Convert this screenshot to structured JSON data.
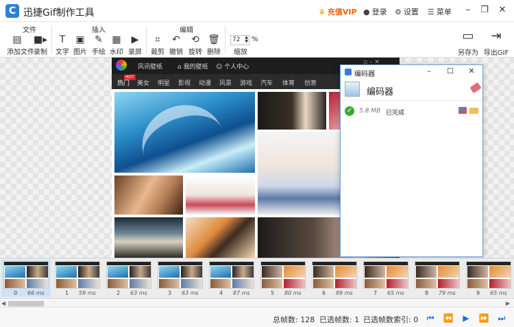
{
  "app": {
    "title": "迅捷Gif制作工具",
    "logo_letter": "C"
  },
  "titlebar": {
    "vip": "充值VIP",
    "login": "登录",
    "settings": "设置",
    "menu": "菜单"
  },
  "ribbon": {
    "groups": {
      "file": "文件",
      "insert": "插入",
      "edit": "编辑"
    },
    "tools": {
      "add_file": "添加文件",
      "record": "录制",
      "text": "文字",
      "image": "图片",
      "draw": "手绘",
      "watermark": "水印",
      "screen_rec": "录屏",
      "crop": "裁剪",
      "undo": "撤销",
      "rotate": "旋转",
      "delete": "删除",
      "zoom_value": "72",
      "zoom_unit": "%",
      "zoom_label": "缩放",
      "save_as": "另存为",
      "export_gif": "导出GIF"
    }
  },
  "site": {
    "links": [
      "风讯壁纸",
      "我的壁纸",
      "个人中心"
    ],
    "nav": [
      "热门",
      "美女",
      "明星",
      "影视",
      "动漫",
      "风景",
      "游戏",
      "汽车",
      "体育",
      "创意"
    ],
    "hot_badge": "HOT"
  },
  "encoder": {
    "title": "编码器",
    "heading": "编码器",
    "size": "5.8 MB",
    "status": "已完成"
  },
  "frames": [
    {
      "idx": "0",
      "ms": "66 ms"
    },
    {
      "idx": "1",
      "ms": "59 ms"
    },
    {
      "idx": "2",
      "ms": "63 ms"
    },
    {
      "idx": "3",
      "ms": "63 ms"
    },
    {
      "idx": "4",
      "ms": "87 ms"
    },
    {
      "idx": "5",
      "ms": "80 ms"
    },
    {
      "idx": "6",
      "ms": "89 ms"
    },
    {
      "idx": "7",
      "ms": "65 ms"
    },
    {
      "idx": "8",
      "ms": "79 ms"
    },
    {
      "idx": "9",
      "ms": "65 ms"
    }
  ],
  "status": {
    "total_frames": "总帧数: 128",
    "selected_frames": "已选帧数: 1",
    "selected_index": "已选帧数索引: 0"
  },
  "colors": {
    "accent": "#1e6ed8",
    "vip": "#e8630a",
    "ok": "#3aaa35"
  }
}
